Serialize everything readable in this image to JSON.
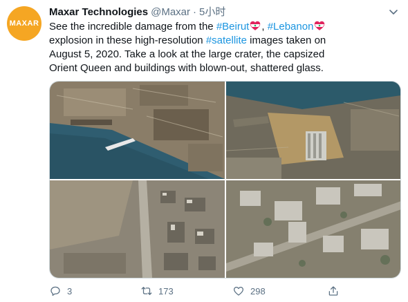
{
  "author": {
    "avatar_text": "MAXAR",
    "name": "Maxar Technologies",
    "handle": "@Maxar",
    "separator": "·",
    "time": "5小时"
  },
  "tweet": {
    "seg1": "See the incredible damage from the ",
    "hashtag_beirut": "#Beirut",
    "seg2": ", ",
    "hashtag_lebanon": "#Lebanon",
    "seg3": " explosion in these high-resolution ",
    "hashtag_satellite": "#satellite",
    "seg4": " images taken on August 5, 2020. Take a look at the large crater, the capsized Orient Queen and buildings with blown-out, shattered glass."
  },
  "actions": {
    "reply_count": "3",
    "retweet_count": "173",
    "like_count": "298"
  },
  "icons": {
    "reply": "reply-icon",
    "retweet": "retweet-icon",
    "like": "heart-icon",
    "share": "share-icon",
    "caret": "chevron-down-icon",
    "flag_heart": "lebanon-flag-heart-icon"
  },
  "colors": {
    "accent": "#1b95e0",
    "secondary_text": "#5b7083",
    "primary_text": "#0f1419",
    "avatar_bg": "#f5a623"
  }
}
